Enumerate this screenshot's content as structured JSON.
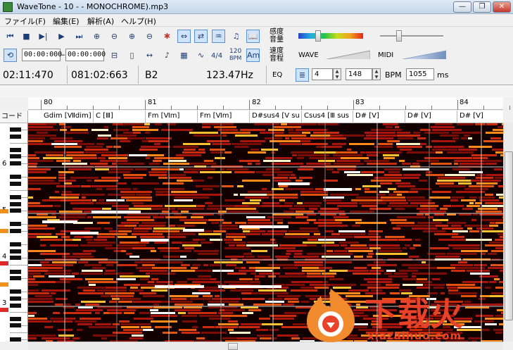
{
  "window": {
    "title": "WaveTone - 10 - - MONOCHROME).mp3",
    "minimize": "—",
    "maximize": "❐",
    "close": "✕"
  },
  "menu": [
    {
      "label": "ファイル(F)"
    },
    {
      "label": "編集(E)"
    },
    {
      "label": "解析(A)"
    },
    {
      "label": "ヘルプ(H)"
    }
  ],
  "toolbar1": [
    "⏮",
    "■",
    "▶|",
    "▶",
    "⏭",
    "⊕",
    "⊖",
    "⊕",
    "⊖",
    "✱",
    "⇔",
    "⇄",
    "♒",
    "♫",
    "📖"
  ],
  "toolbar2": {
    "loop_icon": "⟲",
    "start_time": "00:00:000",
    "dash": "–",
    "end_time": "00:00:000",
    "icons": [
      "⊟",
      "▯",
      "↔",
      "♪",
      "▦",
      "∿"
    ],
    "time_sig": "4/4",
    "bpm_top": "120",
    "bpm_bottom": "BPM",
    "am_label": "Am"
  },
  "right_panel": {
    "sensitivity_line1": "感度",
    "sensitivity_line2": "音量",
    "speed_line1": "速度",
    "speed_line2": "音程",
    "wave_label": "WAVE",
    "midi_label": "MIDI",
    "eq_label": "EQ",
    "beats_value": "4",
    "bpm_value": "148",
    "bpm_label": "BPM",
    "ms_value": "1055",
    "ms_label": "ms"
  },
  "status": {
    "time": "02:11:470",
    "position": "081:02:663",
    "note": "B2",
    "frequency": "123.47Hz"
  },
  "ruler": [
    {
      "label": "80"
    },
    {
      "label": "81"
    },
    {
      "label": "82"
    },
    {
      "label": "83"
    },
    {
      "label": "84"
    }
  ],
  "chord_header": "コード",
  "chords": [
    {
      "label": "Gdim [Ⅶdim]"
    },
    {
      "label": "C [Ⅲ]"
    },
    {
      "label": "Fm [Ⅵm]"
    },
    {
      "label": "Fm [Ⅵm]"
    },
    {
      "label": "D#sus4 [Ⅴ su"
    },
    {
      "label": "Csus4 [Ⅲ sus"
    },
    {
      "label": "D# [Ⅴ]"
    },
    {
      "label": "D# [Ⅴ]"
    },
    {
      "label": "D# [Ⅴ]"
    }
  ],
  "octaves": [
    {
      "label": "6"
    },
    {
      "label": "5"
    },
    {
      "label": "4"
    },
    {
      "label": "3"
    }
  ],
  "watermark": {
    "text": "下载火",
    "sub": "xiazaihuo.com"
  },
  "colors": {
    "accent": "#1c3d75",
    "heat_hot": "#ffffff",
    "heat_warm": "#ff8a1a",
    "heat_cool": "#a8140a",
    "watermark": "#e8432a"
  }
}
